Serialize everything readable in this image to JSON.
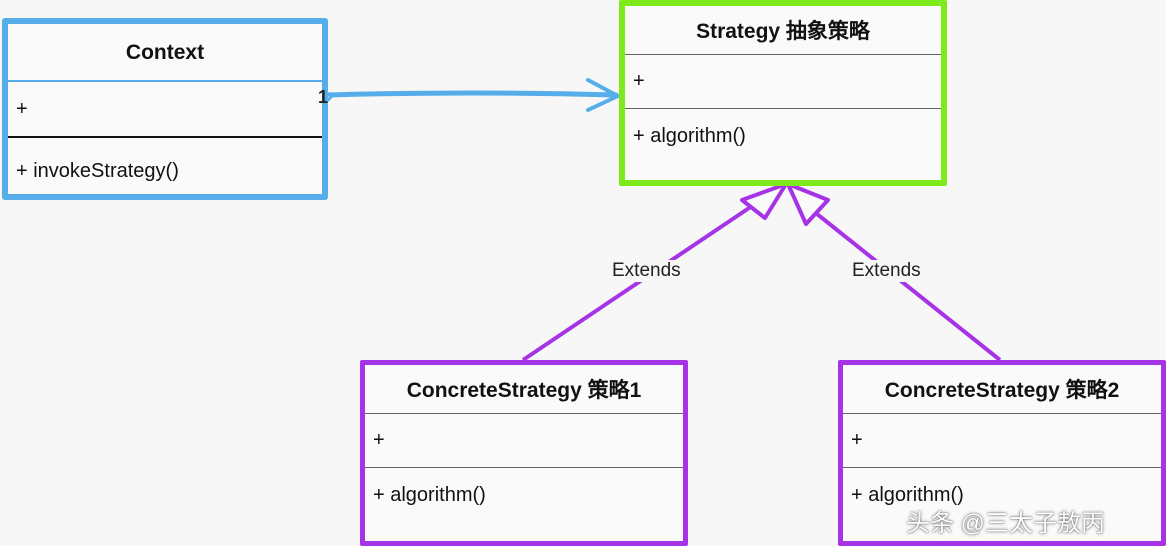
{
  "context": {
    "title": "Context",
    "attribute": "+",
    "operation": "+ invokeStrategy()"
  },
  "strategy": {
    "title": "Strategy 抽象策略",
    "attribute": "+",
    "operation": "+ algorithm()"
  },
  "concrete1": {
    "title": "ConcreteStrategy 策略1",
    "attribute": "+",
    "operation": "+ algorithm()"
  },
  "concrete2": {
    "title": "ConcreteStrategy 策略2",
    "attribute": "+",
    "operation": "+ algorithm()"
  },
  "association": {
    "multiplicity": "1"
  },
  "inheritance": {
    "label_left": "Extends",
    "label_right": "Extends"
  },
  "watermark": "头条 @三太子敖丙",
  "colors": {
    "context": "#55aee9",
    "strategy": "#7fea1b",
    "concrete": "#a633e6"
  }
}
